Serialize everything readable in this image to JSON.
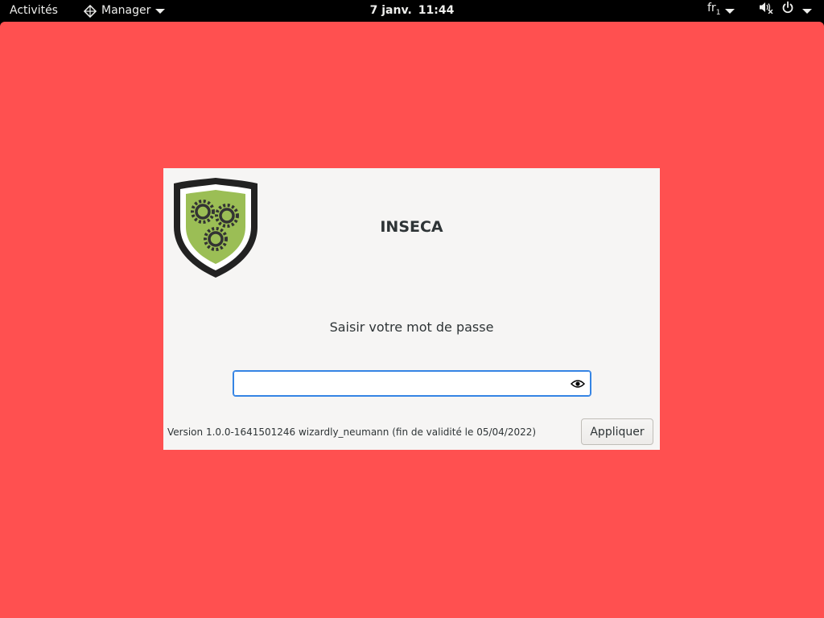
{
  "topbar": {
    "activities_label": "Activités",
    "app_name": "Manager",
    "clock_date": "7 janv.",
    "clock_time": "11:44",
    "keyboard_layout": "fr",
    "keyboard_layout_sub": "1"
  },
  "dialog": {
    "title": "INSECA",
    "prompt": "Saisir votre mot de passe",
    "password_value": "",
    "version_text": "Version 1.0.0-1641501246 wizardly_neumann (fin de validité le 05/04/2022)",
    "apply_label": "Appliquer"
  },
  "colors": {
    "desktop_background": "#ff5050",
    "topbar": "#000000",
    "dialog_background": "#f6f5f4",
    "focus_accent": "#3584e4",
    "logo_shield_fill": "#9bbe55",
    "logo_shield_border": "#222222",
    "logo_gears": "#333333"
  },
  "icons": {
    "app_menu": "app-menu-diamond-icon",
    "keyboard_dropdown": "chevron-down-icon",
    "volume": "speaker-muted-icon",
    "power": "power-icon",
    "system_dropdown": "chevron-down-icon",
    "password_toggle": "eye-icon",
    "logo": "shield-gears-icon"
  }
}
